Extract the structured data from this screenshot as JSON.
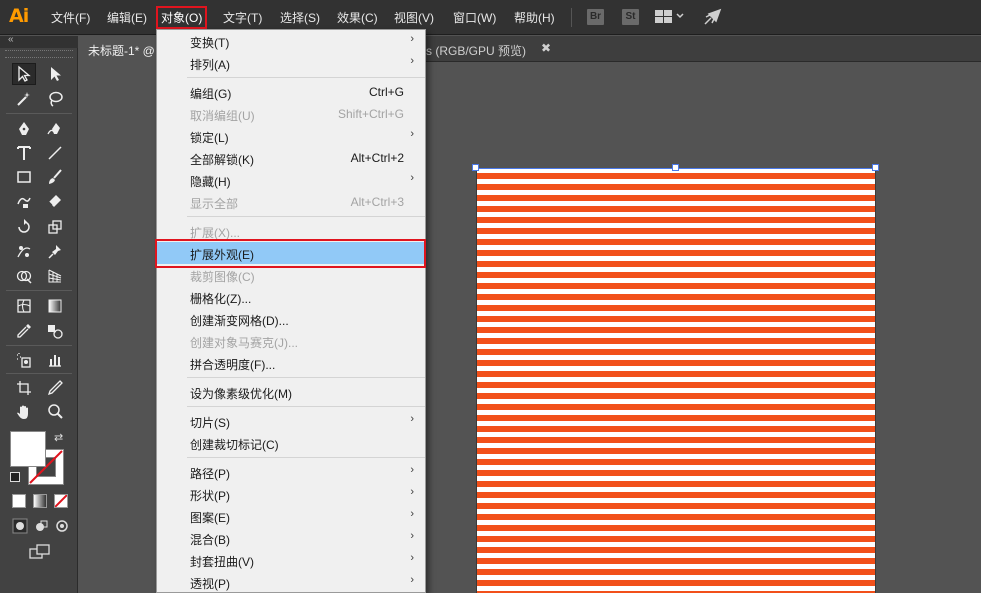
{
  "app": {
    "logo": "Ai"
  },
  "menubar": {
    "items": [
      {
        "id": "file",
        "label": "文件(F)"
      },
      {
        "id": "edit",
        "label": "编辑(E)"
      },
      {
        "id": "object",
        "label": "对象(O)"
      },
      {
        "id": "type",
        "label": "文字(T)"
      },
      {
        "id": "select",
        "label": "选择(S)"
      },
      {
        "id": "effect",
        "label": "效果(C)"
      },
      {
        "id": "view",
        "label": "视图(V)"
      },
      {
        "id": "window",
        "label": "窗口(W)"
      },
      {
        "id": "help",
        "label": "帮助(H)"
      }
    ],
    "bridge_label": "Br",
    "stock_label": "St",
    "workspace_icon": "grid-layout-icon",
    "rocket_icon": "rocket-icon"
  },
  "tabs": {
    "doc1": "未标题-1* @",
    "doc2": "s (RGB/GPU 预览)",
    "close": "✖"
  },
  "object_menu": {
    "groups": [
      [
        {
          "label": "变换(T)",
          "shortcut": "",
          "submenu": true,
          "disabled": false
        },
        {
          "label": "排列(A)",
          "shortcut": "",
          "submenu": true,
          "disabled": false
        }
      ],
      [
        {
          "label": "编组(G)",
          "shortcut": "Ctrl+G",
          "submenu": false,
          "disabled": false
        },
        {
          "label": "取消编组(U)",
          "shortcut": "Shift+Ctrl+G",
          "submenu": false,
          "disabled": true
        },
        {
          "label": "锁定(L)",
          "shortcut": "",
          "submenu": true,
          "disabled": false
        },
        {
          "label": "全部解锁(K)",
          "shortcut": "Alt+Ctrl+2",
          "submenu": false,
          "disabled": false
        },
        {
          "label": "隐藏(H)",
          "shortcut": "",
          "submenu": true,
          "disabled": false
        },
        {
          "label": "显示全部",
          "shortcut": "Alt+Ctrl+3",
          "submenu": false,
          "disabled": true
        }
      ],
      [
        {
          "label": "扩展(X)...",
          "shortcut": "",
          "submenu": false,
          "disabled": true
        },
        {
          "label": "扩展外观(E)",
          "shortcut": "",
          "submenu": false,
          "disabled": false,
          "highlighted": true
        },
        {
          "label": "裁剪图像(C)",
          "shortcut": "",
          "submenu": false,
          "disabled": true
        },
        {
          "label": "栅格化(Z)...",
          "shortcut": "",
          "submenu": false,
          "disabled": false
        },
        {
          "label": "创建渐变网格(D)...",
          "shortcut": "",
          "submenu": false,
          "disabled": false
        },
        {
          "label": "创建对象马赛克(J)...",
          "shortcut": "",
          "submenu": false,
          "disabled": true
        },
        {
          "label": "拼合透明度(F)...",
          "shortcut": "",
          "submenu": false,
          "disabled": false
        }
      ],
      [
        {
          "label": "设为像素级优化(M)",
          "shortcut": "",
          "submenu": false,
          "disabled": false
        }
      ],
      [
        {
          "label": "切片(S)",
          "shortcut": "",
          "submenu": true,
          "disabled": false
        },
        {
          "label": "创建裁切标记(C)",
          "shortcut": "",
          "submenu": false,
          "disabled": false
        }
      ],
      [
        {
          "label": "路径(P)",
          "shortcut": "",
          "submenu": true,
          "disabled": false
        },
        {
          "label": "形状(P)",
          "shortcut": "",
          "submenu": true,
          "disabled": false
        },
        {
          "label": "图案(E)",
          "shortcut": "",
          "submenu": true,
          "disabled": false
        },
        {
          "label": "混合(B)",
          "shortcut": "",
          "submenu": true,
          "disabled": false
        },
        {
          "label": "封套扭曲(V)",
          "shortcut": "",
          "submenu": true,
          "disabled": false
        },
        {
          "label": "透视(P)",
          "shortcut": "",
          "submenu": true,
          "disabled": false
        }
      ]
    ],
    "arrow_glyph": "›"
  },
  "toolbar": {
    "collapse_glyph": "«",
    "tools": [
      "selection-tool-icon",
      "direct-selection-tool-icon",
      "magic-wand-tool-icon",
      "lasso-tool-icon",
      "pen-tool-icon",
      "curvature-tool-icon",
      "type-tool-icon",
      "line-segment-tool-icon",
      "rectangle-tool-icon",
      "paintbrush-tool-icon",
      "shaper-tool-icon",
      "eraser-tool-icon",
      "rotate-tool-icon",
      "scale-tool-icon",
      "puppet-warp-tool-icon",
      "pin-tool-icon",
      "shape-builder-tool-icon",
      "perspective-grid-tool-icon",
      "mesh-tool-icon",
      "gradient-tool-icon",
      "eyedropper-tool-icon",
      "blend-tool-icon",
      "symbol-sprayer-tool-icon",
      "column-graph-tool-icon",
      "artboard-tool-icon",
      "slice-tool-icon",
      "hand-tool-icon",
      "zoom-tool-icon"
    ],
    "swap_glyph": "⇄"
  },
  "colors": {
    "accent_red": "#e0141e",
    "stripe_orange": "#f2501a",
    "menu_highlight": "#91c9f7",
    "selection_blue": "#4a78e8"
  }
}
